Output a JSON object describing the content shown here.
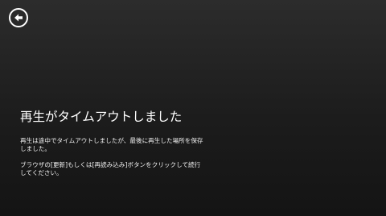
{
  "header": {
    "back_icon": "arrow-left-circle-icon"
  },
  "error": {
    "title": "再生がタイムアウトしました",
    "message_1": "再生は途中でタイムアウトしましたが、最後に再生した場所を保存しました。",
    "message_2": "ブラウザの[更新]もしくは[再読み込み]ボタンをクリックして続行してください。"
  },
  "colors": {
    "background": "#1e1e1e",
    "text": "#ffffff"
  }
}
